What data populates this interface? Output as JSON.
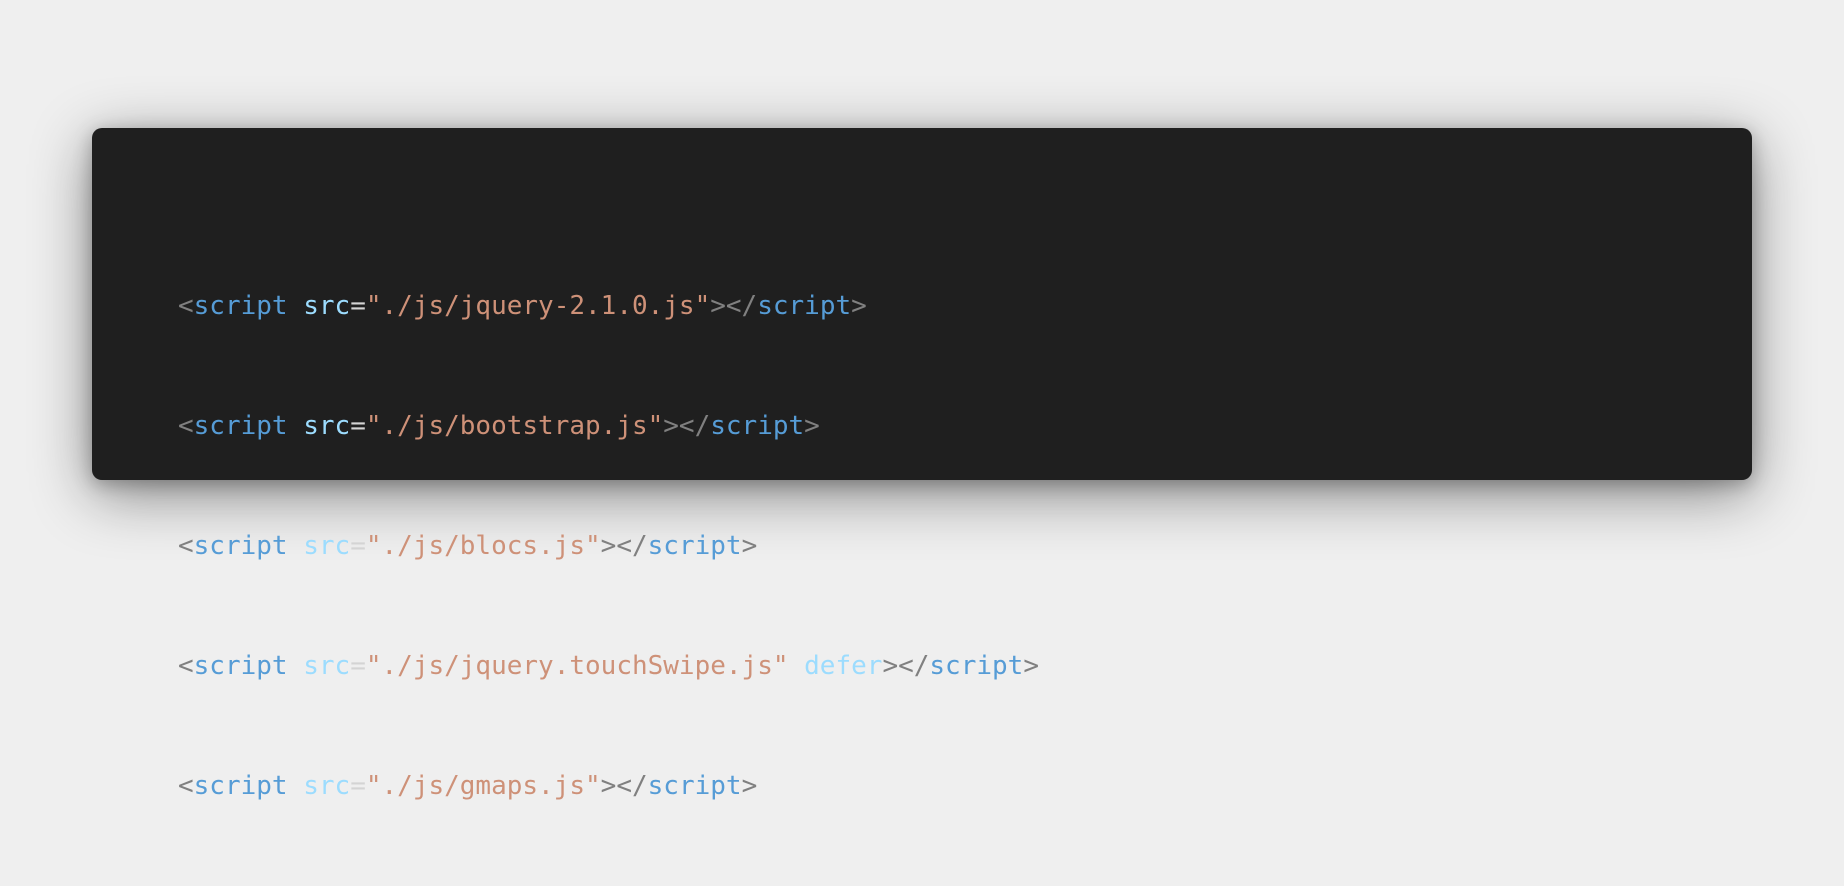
{
  "colors": {
    "page_background": "#efefef",
    "editor_background": "#1f1f1f",
    "punctuation": "#808080",
    "tag_name": "#569cd6",
    "attribute": "#9cdcfe",
    "string": "#ce9178"
  },
  "code": {
    "lines": [
      {
        "tag": "script",
        "attr": "src",
        "value": "\"./js/jquery-2.1.0.js\"",
        "extra_attr": "",
        "close_tag": "script"
      },
      {
        "tag": "script",
        "attr": "src",
        "value": "\"./js/bootstrap.js\"",
        "extra_attr": "",
        "close_tag": "script"
      },
      {
        "tag": "script",
        "attr": "src",
        "value": "\"./js/blocs.js\"",
        "extra_attr": "",
        "close_tag": "script"
      },
      {
        "tag": "script",
        "attr": "src",
        "value": "\"./js/jquery.touchSwipe.js\"",
        "extra_attr": "defer",
        "close_tag": "script"
      },
      {
        "tag": "script",
        "attr": "src",
        "value": "\"./js/gmaps.js\"",
        "extra_attr": "",
        "close_tag": "script"
      }
    ]
  }
}
